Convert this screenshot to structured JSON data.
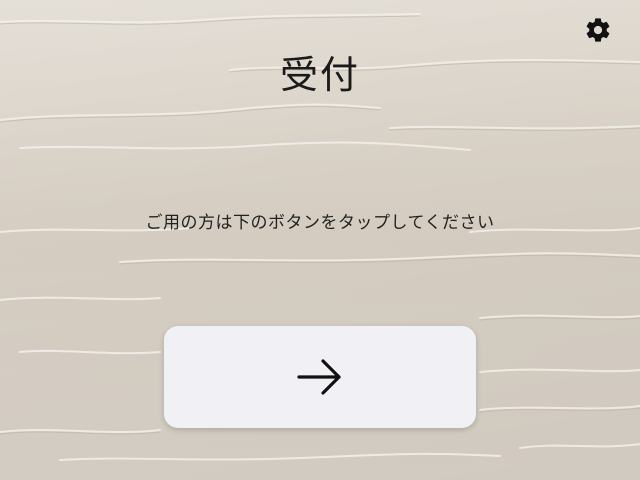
{
  "screen": {
    "title": "受付",
    "instruction": "ご用の方は下のボタンをタップしてください"
  },
  "icons": {
    "settings": "gear-icon",
    "next": "arrow-right-icon"
  },
  "colors": {
    "background": "#d9d1c6",
    "button": "#f1f0f5",
    "text": "#1a1a1a"
  }
}
